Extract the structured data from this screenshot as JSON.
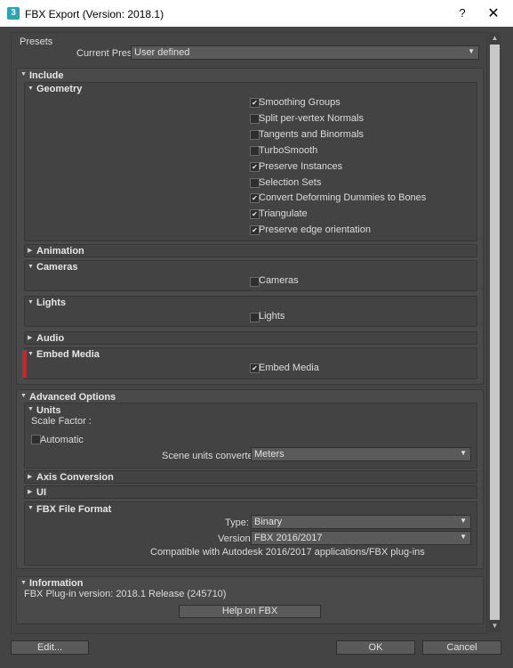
{
  "window": {
    "title": "FBX Export (Version: 2018.1)",
    "app_icon_text": "3",
    "help_glyph": "?",
    "close_glyph": "✕"
  },
  "presets": {
    "header": "Presets",
    "current_preset_label": "Current Preset:",
    "current_preset_value": "User defined"
  },
  "include": {
    "header": "Include",
    "geometry": {
      "header": "Geometry",
      "options": [
        {
          "label": "Smoothing Groups",
          "checked": true
        },
        {
          "label": "Split per-vertex Normals",
          "checked": false
        },
        {
          "label": "Tangents and Binormals",
          "checked": false
        },
        {
          "label": "TurboSmooth",
          "checked": false
        },
        {
          "label": "Preserve Instances",
          "checked": true
        },
        {
          "label": "Selection Sets",
          "checked": false
        },
        {
          "label": "Convert Deforming Dummies to Bones",
          "checked": true
        },
        {
          "label": "Triangulate",
          "checked": true
        },
        {
          "label": "Preserve edge orientation",
          "checked": true
        }
      ]
    },
    "animation": {
      "header": "Animation"
    },
    "cameras": {
      "header": "Cameras",
      "option": {
        "label": "Cameras",
        "checked": false
      }
    },
    "lights": {
      "header": "Lights",
      "option": {
        "label": "Lights",
        "checked": false
      }
    },
    "audio": {
      "header": "Audio"
    },
    "embed_media": {
      "header": "Embed Media",
      "option": {
        "label": "Embed Media",
        "checked": true
      }
    }
  },
  "advanced": {
    "header": "Advanced Options",
    "units": {
      "header": "Units",
      "scale_factor_label": "Scale Factor :",
      "automatic": {
        "label": "Automatic",
        "checked": false
      },
      "scene_units_label": "Scene units converted to:",
      "scene_units_value": "Meters"
    },
    "axis_conversion": {
      "header": "Axis Conversion"
    },
    "ui": {
      "header": "UI"
    },
    "fbx_file_format": {
      "header": "FBX File Format",
      "type_label": "Type:",
      "type_value": "Binary",
      "version_label": "Version:",
      "version_value": "FBX 2016/2017",
      "compat_text": "Compatible with Autodesk 2016/2017 applications/FBX plug-ins"
    }
  },
  "information": {
    "header": "Information",
    "plugin_version": "FBX Plug-in version: 2018.1 Release (245710)",
    "help_button": "Help on FBX"
  },
  "footer": {
    "edit_button": "Edit...",
    "ok_button": "OK",
    "cancel_button": "Cancel"
  },
  "glyphs": {
    "expanded": "▼",
    "collapsed": "▶",
    "dropdown_arrow": "▼",
    "check": "✔"
  }
}
